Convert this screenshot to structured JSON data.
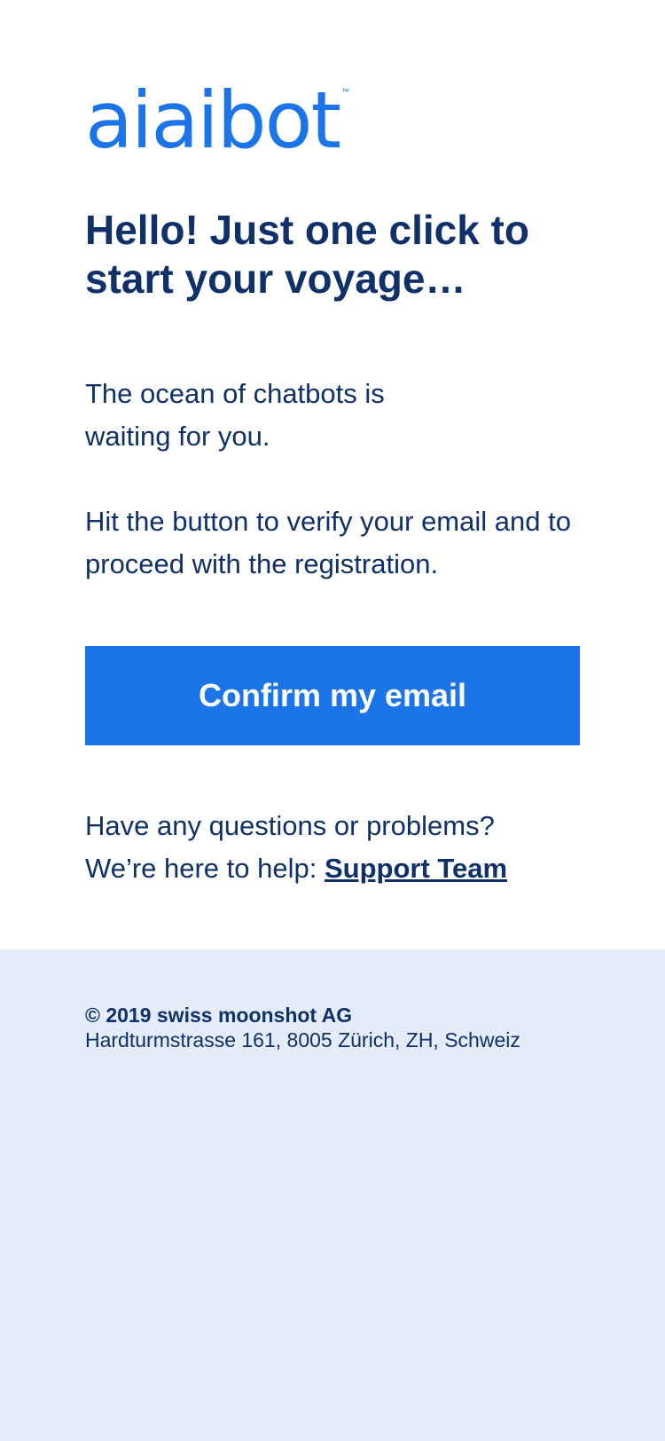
{
  "brand": {
    "logo_text": "aiaibot",
    "trademark": "™",
    "accent_color": "#1b74e8",
    "text_color": "#0f3068",
    "footer_bg": "#e3ecf8"
  },
  "email": {
    "heading": "Hello! Just one click to start your voyage…",
    "intro": "The ocean of chatbots is waiting for you.",
    "instructions": "Hit the button to verify your email and to proceed with the registration.",
    "confirm_button": "Confirm my email",
    "help_question": "Have any questions or problems?",
    "help_prefix": "We’re here to help: ",
    "support_link": "Support Team"
  },
  "footer": {
    "copyright": "© 2019 swiss moonshot AG",
    "address": "Hardturmstrasse 161, 8005 Zürich, ZH, Schweiz"
  }
}
